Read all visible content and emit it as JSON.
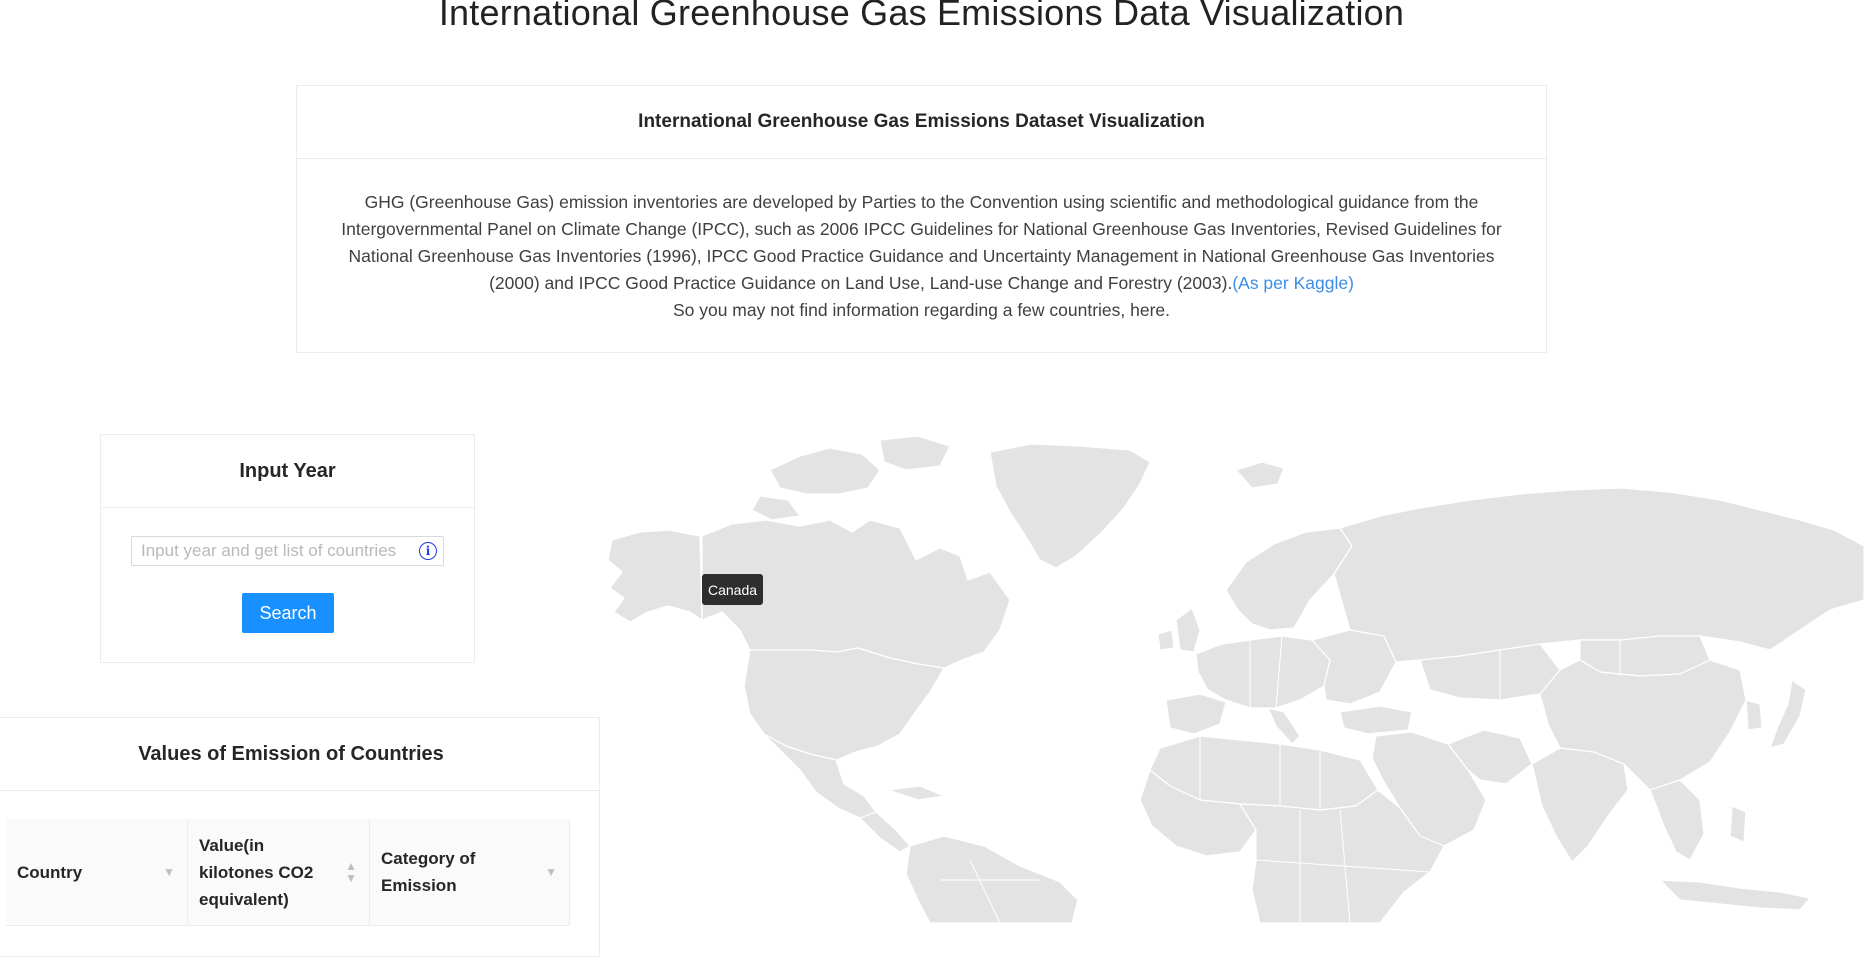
{
  "page": {
    "title": "International Greenhouse Gas Emissions Data Visualization"
  },
  "intro": {
    "heading": "International Greenhouse Gas Emissions Dataset Visualization",
    "paragraph": "GHG (Greenhouse Gas) emission inventories are developed by Parties to the Convention using scientific and methodological guidance from the Intergovernmental Panel on Climate Change (IPCC), such as 2006 IPCC Guidelines for National Greenhouse Gas Inventories, Revised Guidelines for National Greenhouse Gas Inventories (1996), IPCC Good Practice Guidance and Uncertainty Management in National Greenhouse Gas Inventories (2000) and IPCC Good Practice Guidance on Land Use, Land-use Change and Forestry (2003).",
    "source_link": "(As per Kaggle)",
    "note": "So you may not find information regarding a few countries, here."
  },
  "year_panel": {
    "heading": "Input Year",
    "input_value": "",
    "input_placeholder": "Input year and get list of countries",
    "info_icon": "info-circle-icon",
    "search_label": "Search"
  },
  "emissions_panel": {
    "heading": "Values of Emission of Countries",
    "columns": [
      {
        "label": "Country",
        "icon": "filter-icon"
      },
      {
        "label": "Value(in kilotones CO2 equivalent)",
        "icon": "sort-icon"
      },
      {
        "label": "Category of Emission",
        "icon": "filter-icon"
      }
    ]
  },
  "map": {
    "hover_tooltip": "Canada",
    "land_color": "#e3e3e3",
    "border_color": "#ffffff"
  },
  "colors": {
    "primary": "#1890ff",
    "link": "#3b8de8",
    "tooltip_bg": "#2e2e2e"
  }
}
